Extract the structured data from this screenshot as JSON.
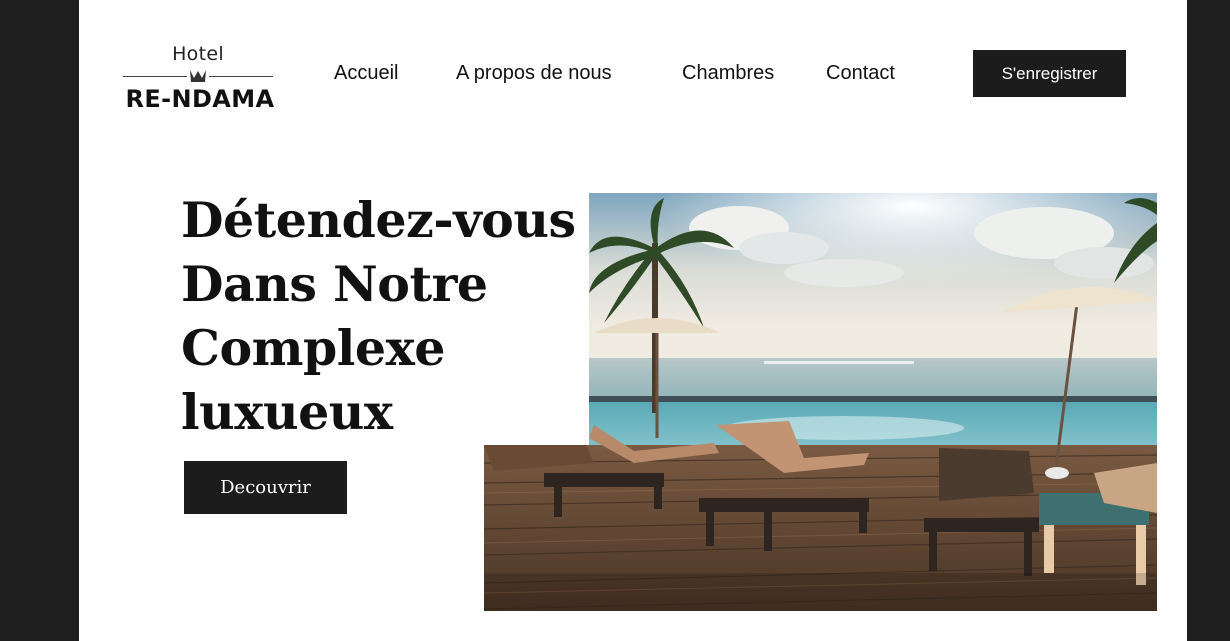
{
  "logo": {
    "top_text": "Hotel",
    "bottom_text": "RE-NDAMA"
  },
  "nav": {
    "items": [
      {
        "label": "Accueil"
      },
      {
        "label": "A propos de nous"
      },
      {
        "label": "Chambres"
      },
      {
        "label": "Contact"
      }
    ],
    "register_label": "S'enregistrer"
  },
  "hero": {
    "title_lines": [
      "Détendez-vous",
      "Dans Notre",
      "Complexe",
      "luxueux"
    ],
    "cta_label": "Decouvrir"
  },
  "colors": {
    "button_bg": "#1c1c1c",
    "side_panels": "#1e1e1e"
  }
}
